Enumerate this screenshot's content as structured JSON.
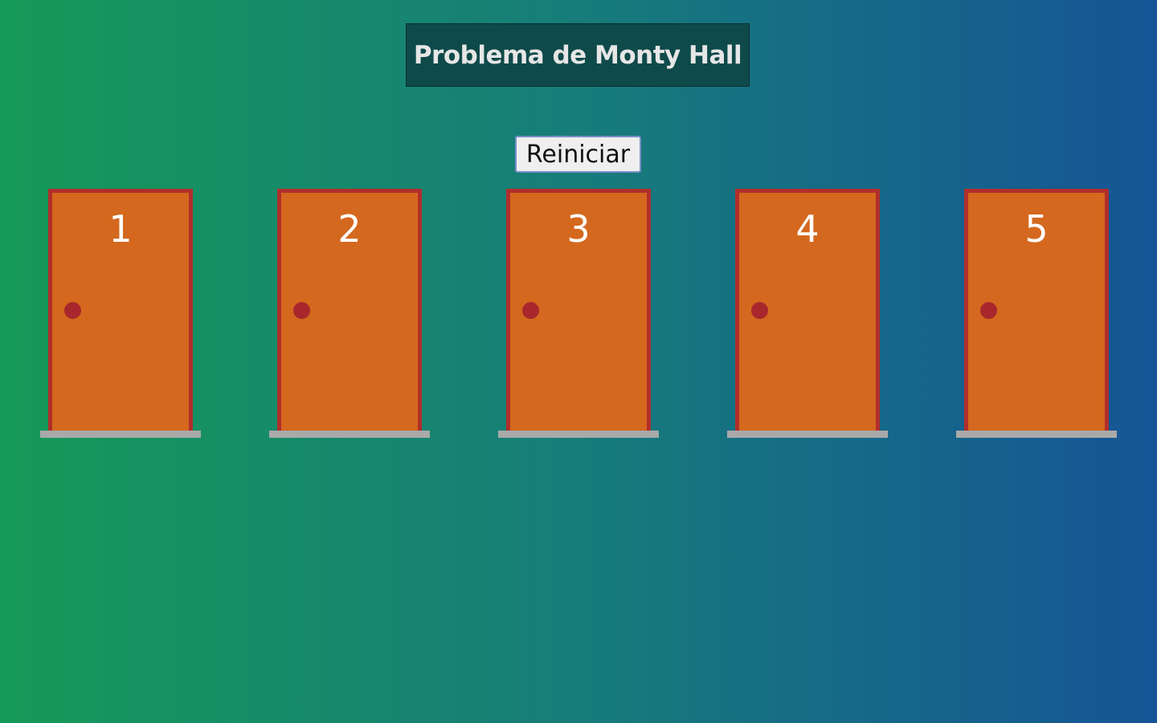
{
  "header": {
    "title": "Problema de Monty Hall"
  },
  "controls": {
    "restart_label": "Reiniciar"
  },
  "doors": [
    {
      "number": "1"
    },
    {
      "number": "2"
    },
    {
      "number": "3"
    },
    {
      "number": "4"
    },
    {
      "number": "5"
    }
  ],
  "colors": {
    "door": "#d4681f",
    "door_frame": "#b12e2b",
    "knob": "#a8272c",
    "step": "#a9a9a9",
    "background_left": "#169a58",
    "background_right": "#155596"
  }
}
